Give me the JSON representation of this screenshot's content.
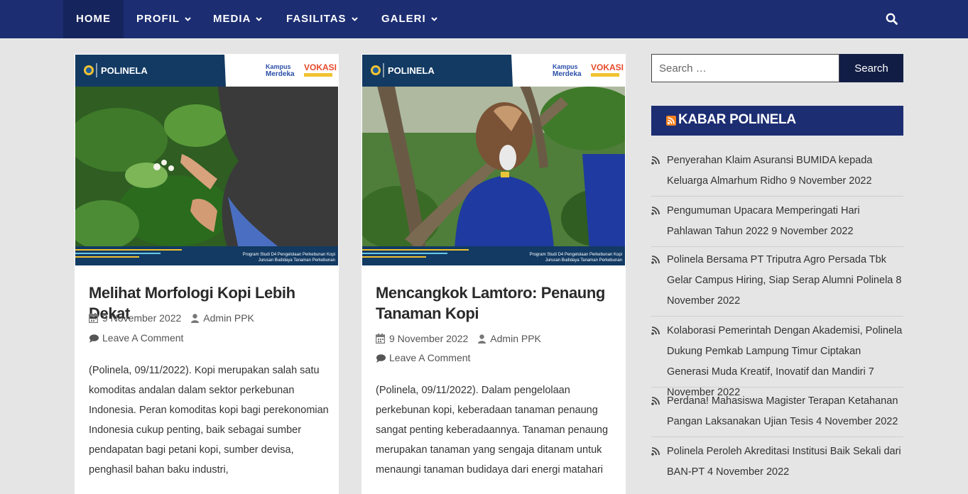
{
  "nav": {
    "home": "HOME",
    "items": [
      "PROFIL",
      "MEDIA",
      "FASILITAS",
      "GALERI"
    ]
  },
  "posts": [
    {
      "banner_brand": "POLINELA",
      "banner_caption_1": "Program Studi D4 Pengelolaan Perkebunan Kopi",
      "banner_caption_2": "Jurusan Budidaya Tanaman Perkebunan",
      "title": "Melihat Morfologi Kopi Lebih Dekat",
      "date": "9 November 2022",
      "author": "Admin PPK",
      "comment": "Leave A Comment",
      "excerpt": "(Polinela, 09/11/2022). Kopi merupakan salah satu komoditas andalan dalam sektor perkebunan Indonesia. Peran komoditas kopi bagi perekonomian Indonesia cukup penting, baik sebagai sumber pendapatan bagi petani kopi, sumber devisa, penghasil bahan baku industri,"
    },
    {
      "banner_brand": "POLINELA",
      "banner_caption_1": "Program Studi D4 Pengelolaan Perkebunan Kopi",
      "banner_caption_2": "Jurusan Budidaya Tanaman Perkebunan",
      "title": "Mencangkok Lamtoro: Penaung Tanaman Kopi",
      "date": "9 November 2022",
      "author": "Admin PPK",
      "comment": "Leave A Comment",
      "excerpt": "(Polinela, 09/11/2022). Dalam pengelolaan perkebunan kopi, keberadaan tanaman penaung sangat penting  keberadaannya. Tanaman penaung merupakan tanaman yang sengaja ditanam untuk menaungi tanaman budidaya dari energi matahari"
    }
  ],
  "sidebar": {
    "search_placeholder": "Search …",
    "search_button": "Search",
    "widget_title": "KABAR POLINELA",
    "news": [
      "Penyerahan Klaim Asuransi BUMIDA kepada Keluarga Almarhum Ridho 9 November 2022",
      "Pengumuman Upacara Memperingati Hari Pahlawan Tahun 2022 9 November 2022",
      "Polinela Bersama PT Triputra Agro Persada Tbk Gelar Campus Hiring, Siap Serap Alumni Polinela 8 November 2022",
      "Kolaborasi Pemerintah Dengan Akademisi, Polinela Dukung Pemkab Lampung Timur Ciptakan Generasi Muda Kreatif, Inovatif dan Mandiri 7 November 2022",
      "Perdana! Mahasiswa Magister Terapan Ketahanan Pangan Laksanakan Ujian Tesis 4 November 2022",
      "Polinela Peroleh Akreditasi Institusi Baik Sekali dari BAN-PT 4 November 2022"
    ]
  },
  "colors": {
    "nav_bg": "#1c2d72",
    "page_bg": "#e5e5e5",
    "search_button_bg": "#111d45",
    "rss_orange": "#f58220"
  }
}
